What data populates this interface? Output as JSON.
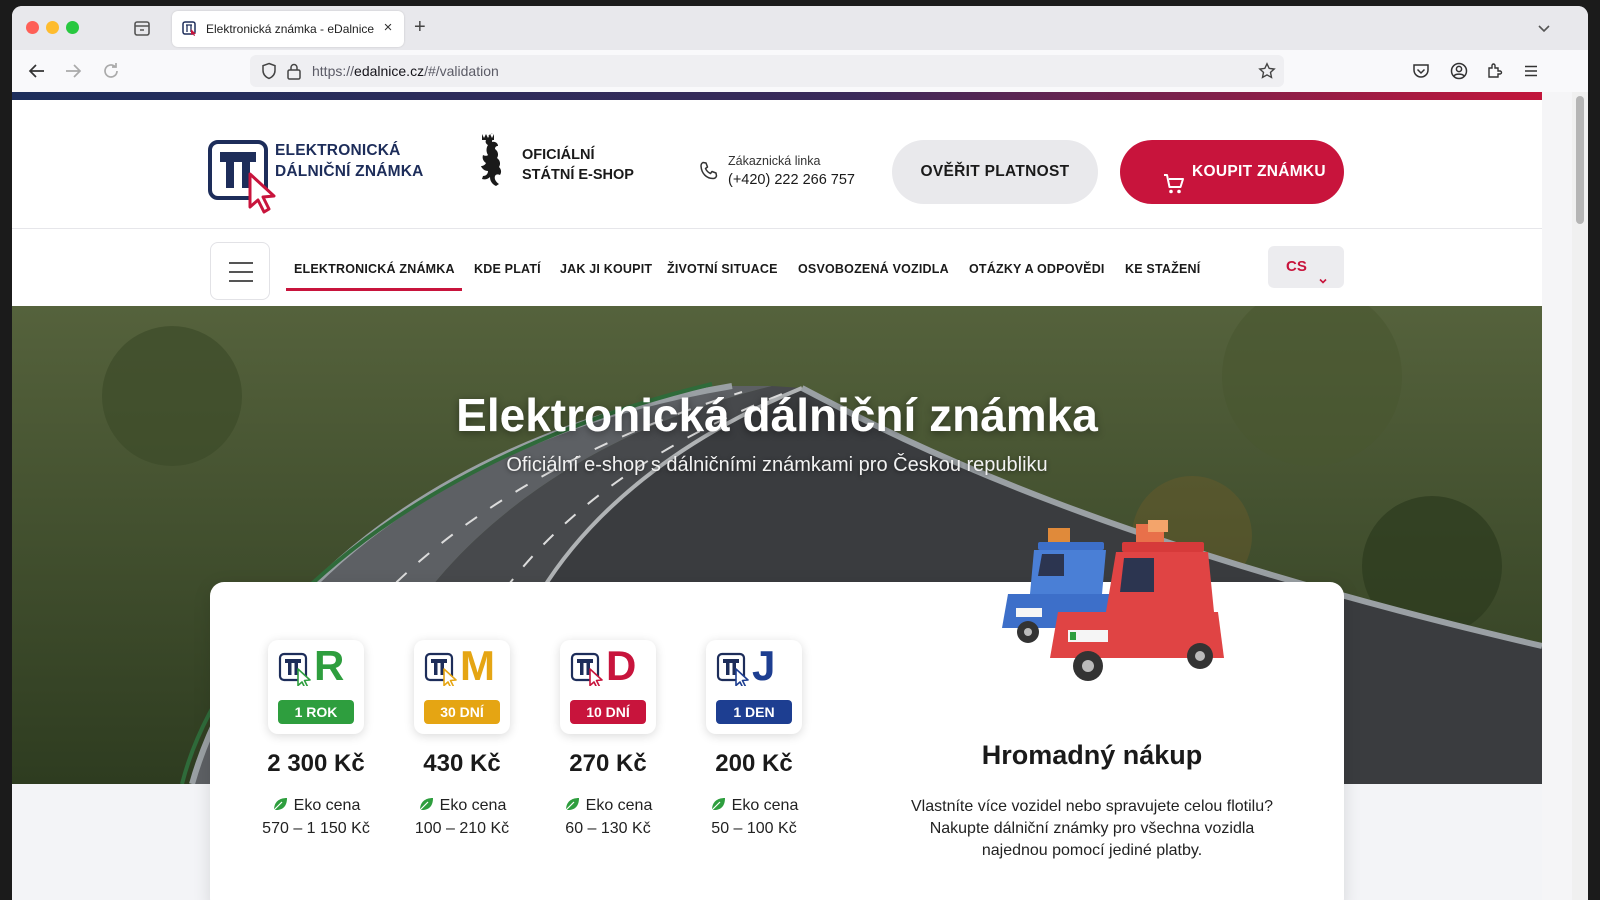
{
  "browser": {
    "tab_title": "Elektronická známka - eDalnice",
    "url_prefix": "https://",
    "url_domain": "edalnice.cz",
    "url_path": "/#/validation"
  },
  "header": {
    "logo_line1": "ELEKTRONICKÁ",
    "logo_line2": "DÁLNIČNÍ ZNÁMKA",
    "gov_line1": "OFICIÁLNÍ",
    "gov_line2": "STÁTNÍ E-SHOP",
    "contact_label": "Zákaznická linka",
    "contact_phone": "(+420) 222 266 757",
    "verify_label": "OVĚŘIT PLATNOST",
    "buy_label": "KOUPIT ZNÁMKU"
  },
  "nav": {
    "items": [
      {
        "label": "ELEKTRONICKÁ ZNÁMKA",
        "active": true
      },
      {
        "label": "KDE PLATÍ"
      },
      {
        "label": "JAK JI KOUPIT"
      },
      {
        "label": "ŽIVOTNÍ SITUACE"
      },
      {
        "label": "OSVOBOZENÁ VOZIDLA"
      },
      {
        "label": "OTÁZKY A ODPOVĚDI"
      },
      {
        "label": "KE STAŽENÍ"
      }
    ],
    "language": "CS"
  },
  "hero": {
    "title": "Elektronická dálniční známka",
    "subtitle": "Oficiální e-shop s dálničními známkami pro Českou republiku"
  },
  "vignettes": [
    {
      "letter": "R",
      "period": "1 ROK",
      "price": "2 300 Kč",
      "eko_label": "Eko cena",
      "eko_range": "570 – 1 150 Kč",
      "color": "#2e9e3e"
    },
    {
      "letter": "M",
      "period": "30 DNÍ",
      "price": "430 Kč",
      "eko_label": "Eko cena",
      "eko_range": "100 – 210 Kč",
      "color": "#e5a513"
    },
    {
      "letter": "D",
      "period": "10 DNÍ",
      "price": "270 Kč",
      "eko_label": "Eko cena",
      "eko_range": "60 – 130 Kč",
      "color": "#c8143c"
    },
    {
      "letter": "J",
      "period": "1 DEN",
      "price": "200 Kč",
      "eko_label": "Eko cena",
      "eko_range": "50 – 100 Kč",
      "color": "#1d3e91"
    }
  ],
  "bulk": {
    "title": "Hromadný nákup",
    "line1": "Vlastníte více vozidel nebo spravujete celou flotilu?",
    "line2": "Nakupte dálniční známky pro všechna vozidla",
    "line3": "najednou pomocí jediné platby."
  },
  "colors": {
    "brand_red": "#c8143c",
    "brand_navy": "#1d2d5a"
  }
}
